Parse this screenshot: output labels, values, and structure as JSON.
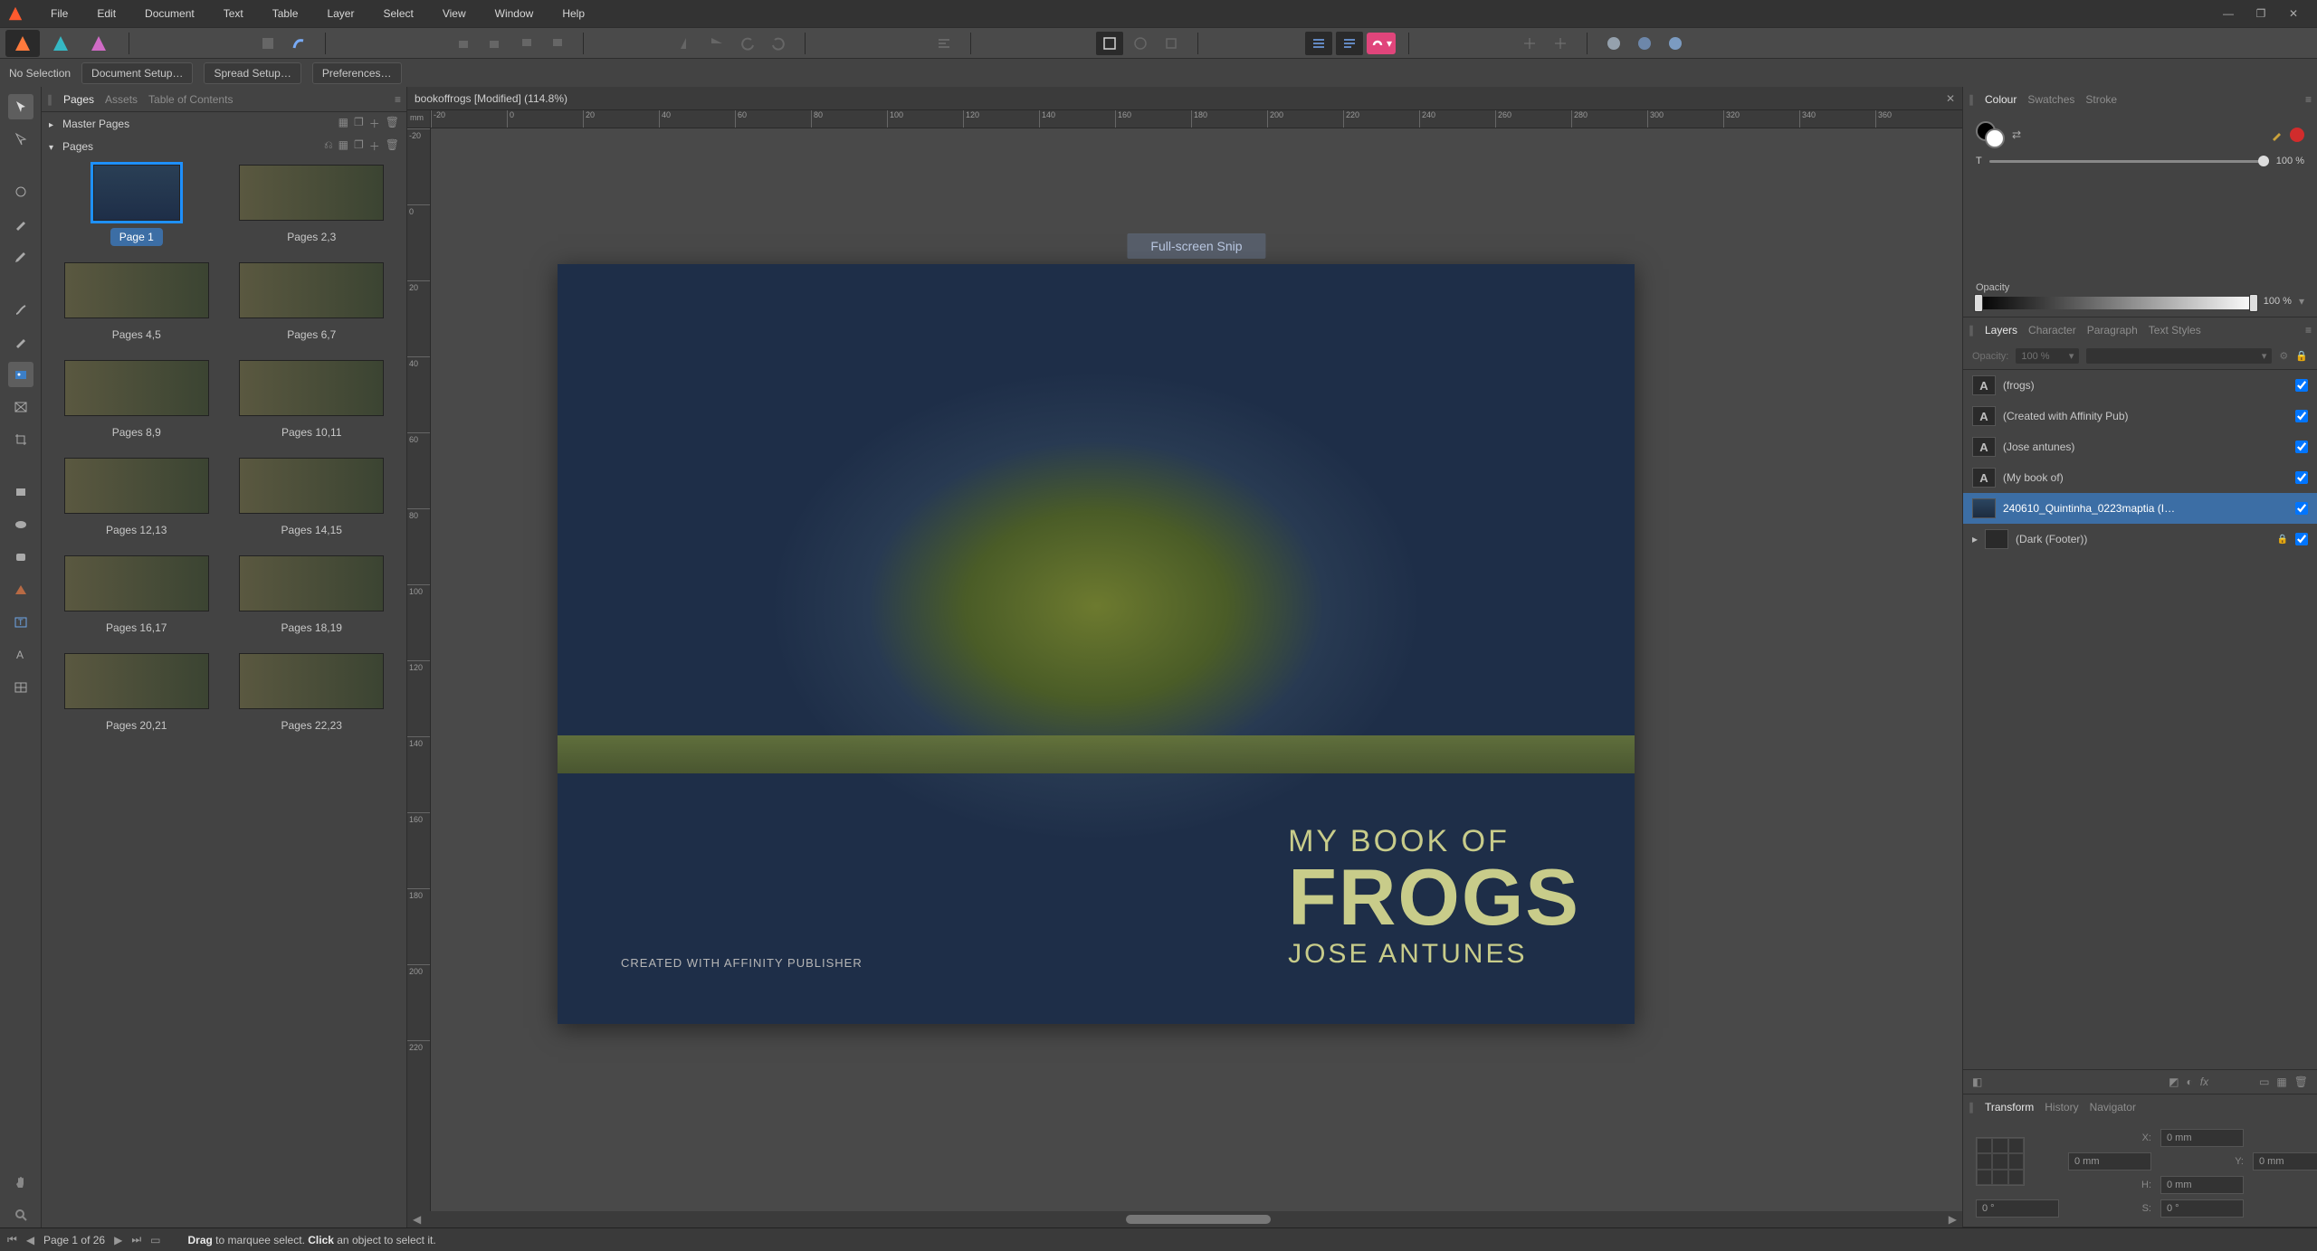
{
  "menu": [
    "File",
    "Edit",
    "Document",
    "Text",
    "Table",
    "Layer",
    "Select",
    "View",
    "Window",
    "Help"
  ],
  "context_bar": {
    "selection": "No Selection",
    "buttons": [
      "Document Setup…",
      "Spread Setup…",
      "Preferences…"
    ]
  },
  "document": {
    "tab_title": "bookoffrogs [Modified] (114.8%)",
    "ruler_unit": "mm",
    "ruler_h": [
      "-20",
      "0",
      "20",
      "40",
      "60",
      "80",
      "100",
      "120",
      "140",
      "160",
      "180",
      "200",
      "220",
      "240",
      "260",
      "280",
      "300",
      "320",
      "340",
      "360"
    ],
    "ruler_v": [
      "-20",
      "0",
      "20",
      "40",
      "60",
      "80",
      "100",
      "120",
      "140",
      "160",
      "180",
      "200",
      "220"
    ]
  },
  "pages_panel": {
    "tabs": [
      "Pages",
      "Assets",
      "Table of Contents"
    ],
    "sections": {
      "master": "Master Pages",
      "pages": "Pages"
    },
    "thumbs": [
      {
        "label": "Page 1",
        "selected": true,
        "single": true
      },
      {
        "label": "Pages 2,3"
      },
      {
        "label": "Pages 4,5"
      },
      {
        "label": "Pages 6,7"
      },
      {
        "label": "Pages 8,9"
      },
      {
        "label": "Pages 10,11"
      },
      {
        "label": "Pages 12,13"
      },
      {
        "label": "Pages 14,15"
      },
      {
        "label": "Pages 16,17"
      },
      {
        "label": "Pages 18,19"
      },
      {
        "label": "Pages 20,21"
      },
      {
        "label": "Pages 22,23"
      }
    ]
  },
  "cover": {
    "line1": "MY BOOK OF",
    "line2": "FROGS",
    "author": "JOSE ANTUNES",
    "credit": "CREATED WITH AFFINITY PUBLISHER"
  },
  "snip_badge": "Full-screen Snip",
  "right": {
    "colour_tabs": [
      "Colour",
      "Swatches",
      "Stroke"
    ],
    "tint_label": "T",
    "tint_value": "100 %",
    "opacity_label": "Opacity",
    "opacity_value": "100 %",
    "layer_tabs": [
      "Layers",
      "Character",
      "Paragraph",
      "Text Styles"
    ],
    "layer_opacity_label": "Opacity:",
    "layer_opacity_value": "100 %",
    "layers": [
      {
        "name": "(frogs)",
        "type": "A"
      },
      {
        "name": "(Created with Affinity Pub)",
        "type": "A"
      },
      {
        "name": "(Jose antunes)",
        "type": "A"
      },
      {
        "name": "(My book of)",
        "type": "A"
      },
      {
        "name": "240610_Quintinha_0223maptia (I…",
        "type": "img",
        "selected": true
      },
      {
        "name": "(Dark (Footer))",
        "type": "grp",
        "locked": true
      }
    ],
    "transform_tabs": [
      "Transform",
      "History",
      "Navigator"
    ],
    "transform": {
      "x": "0 mm",
      "y": "0 mm",
      "w": "0 mm",
      "h": "0 mm",
      "r": "0 °",
      "s": "0 °"
    }
  },
  "status": {
    "page_text": "Page 1 of 26",
    "hint_drag": "Drag",
    "hint_drag_rest": " to marquee select. ",
    "hint_click": "Click",
    "hint_click_rest": " an object to select it."
  }
}
